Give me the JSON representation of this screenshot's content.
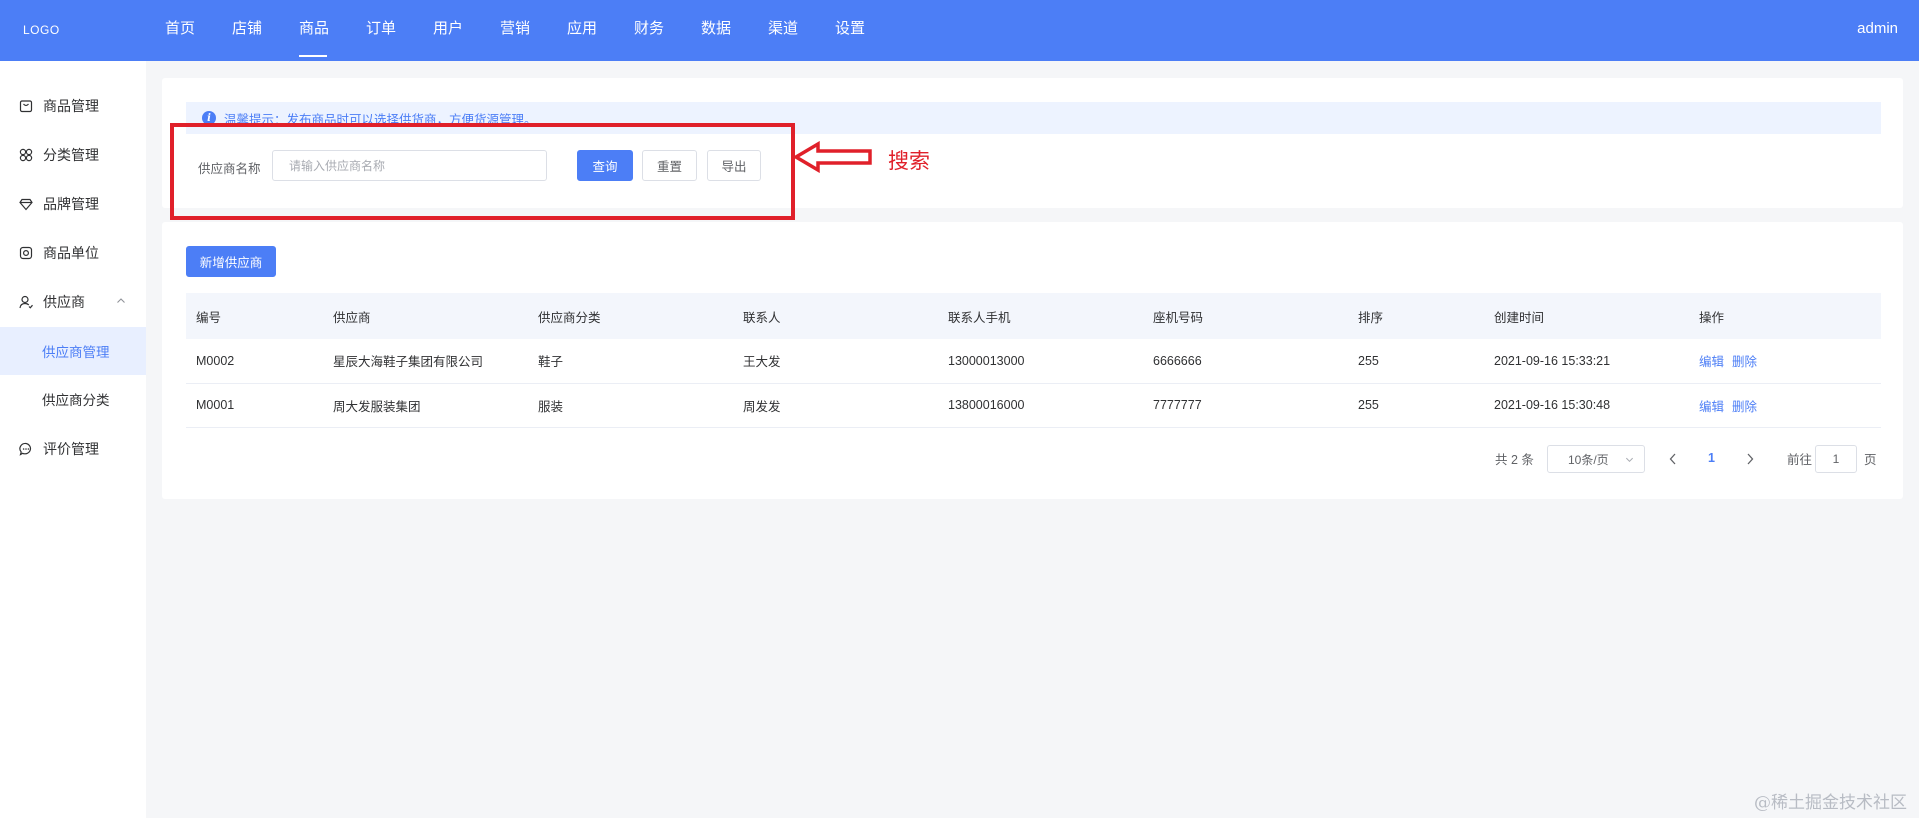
{
  "header": {
    "logo": "LOGO",
    "nav": [
      "首页",
      "店铺",
      "商品",
      "订单",
      "用户",
      "营销",
      "应用",
      "财务",
      "数据",
      "渠道",
      "设置"
    ],
    "active_nav": "商品",
    "user": "admin"
  },
  "sidebar": {
    "items": [
      {
        "label": "商品管理",
        "icon": "bag-icon"
      },
      {
        "label": "分类管理",
        "icon": "grid-icon"
      },
      {
        "label": "品牌管理",
        "icon": "diamond-icon"
      },
      {
        "label": "商品单位",
        "icon": "camera-icon"
      },
      {
        "label": "供应商",
        "icon": "user-icon",
        "expanded": true
      },
      {
        "label": "供应商管理",
        "sub": true,
        "active": true
      },
      {
        "label": "供应商分类",
        "sub": true
      },
      {
        "label": "评价管理",
        "icon": "chat-icon"
      }
    ]
  },
  "search": {
    "tip": "温馨提示：发布商品时可以选择供货商，方便货源管理。",
    "label": "供应商名称",
    "placeholder": "请输入供应商名称",
    "query_label": "查询",
    "reset_label": "重置",
    "export_label": "导出"
  },
  "annotation": {
    "text": "搜索",
    "color": "#e0202a"
  },
  "table": {
    "add_label": "新增供应商",
    "columns": [
      "编号",
      "供应商",
      "供应商分类",
      "联系人",
      "联系人手机",
      "座机号码",
      "排序",
      "创建时间",
      "操作"
    ],
    "rows": [
      {
        "id": "M0002",
        "name": "星辰大海鞋子集团有限公司",
        "category": "鞋子",
        "contact": "王大发",
        "mobile": "13000013000",
        "phone": "6666666",
        "sort": "255",
        "created": "2021-09-16 15:33:21"
      },
      {
        "id": "M0001",
        "name": "周大发服装集团",
        "category": "服装",
        "contact": "周发发",
        "mobile": "13800016000",
        "phone": "7777777",
        "sort": "255",
        "created": "2021-09-16 15:30:48"
      }
    ],
    "edit_label": "编辑",
    "delete_label": "删除"
  },
  "pagination": {
    "total": "共 2 条",
    "page_size": "10条/页",
    "current_page": "1",
    "goto_label": "前往",
    "goto_value": "1",
    "page_suffix": "页"
  },
  "watermark": "@稀土掘金技术社区",
  "colors": {
    "primary": "#4c7ef6",
    "annotation": "#e0202a"
  }
}
